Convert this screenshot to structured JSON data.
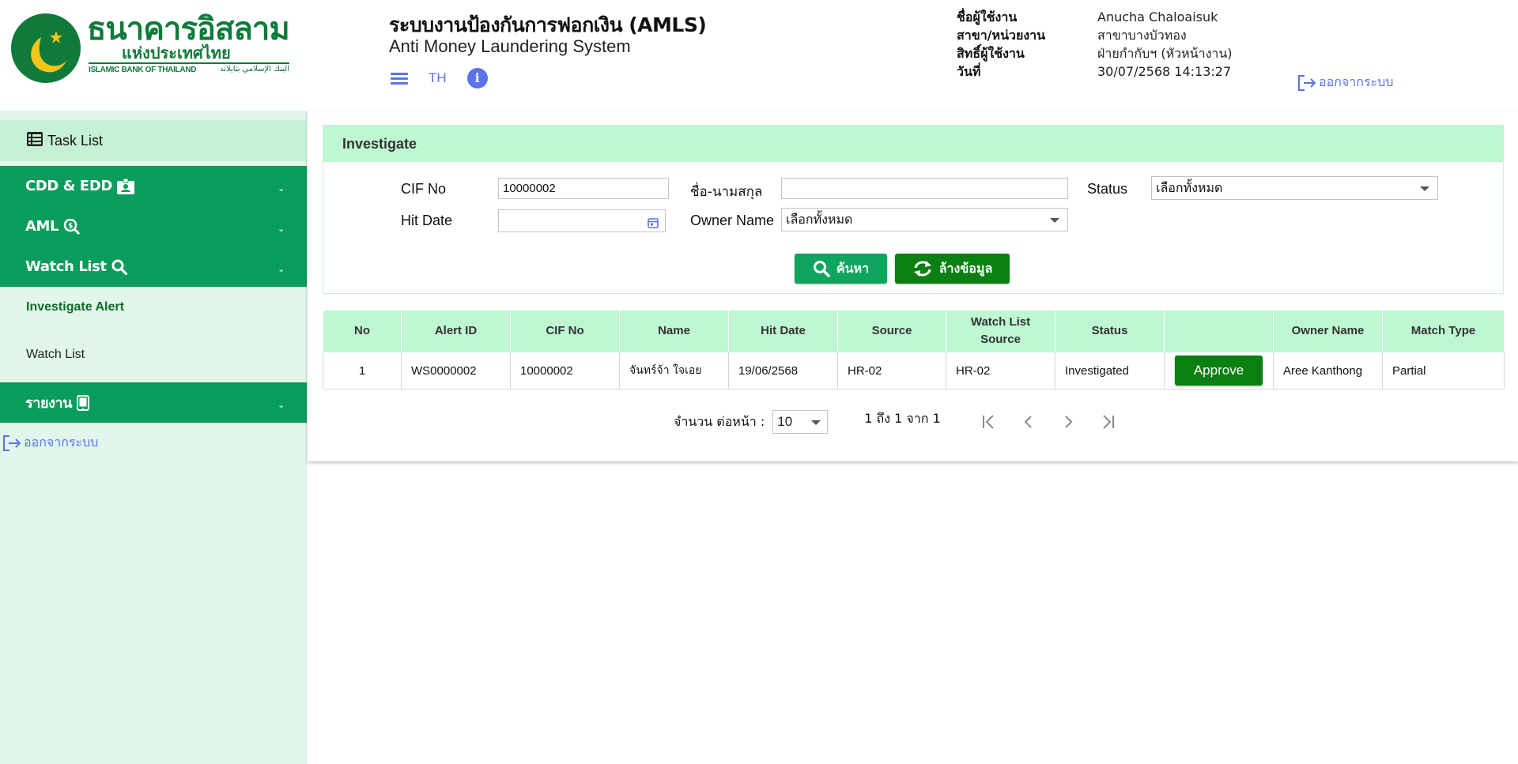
{
  "header": {
    "logo_th": "ธนาคารอิสลาม",
    "logo_th2": "แห่งประเทศไทย",
    "logo_en": "ISLAMIC BANK OF THAILAND",
    "logo_ar": "البنك الإسلامي بتايلاند",
    "system_title": "ระบบงานป้องกันการฟอกเงิน (AMLS)",
    "system_subtitle": "Anti Money Laundering System",
    "lang": "TH",
    "info_icon": "info-icon",
    "user": {
      "username_label": "ชื่อผู้ใช้งาน",
      "username": "Anucha Chaloaisuk",
      "branch_label": "สาขา/หน่วยงาน",
      "branch": "สาขาบางบัวทอง",
      "role_label": "สิทธิ์ผู้ใช้งาน",
      "role": "ฝ่ายกำกับฯ (หัวหน้างาน)",
      "date_label": "วันที่",
      "date": "30/07/2568 14:13:27"
    },
    "logout": "ออกจากระบบ"
  },
  "sidebar": {
    "task_list": "Task List",
    "groups": [
      {
        "label": "CDD & EDD",
        "icon": "id-badge-icon"
      },
      {
        "label": "AML",
        "icon": "money-search-icon"
      },
      {
        "label": "Watch List",
        "icon": "search-icon"
      }
    ],
    "sub_items": [
      "Investigate Alert",
      "Watch List"
    ],
    "report": {
      "label": "รายงาน",
      "icon": "tablet-icon"
    },
    "logout": "ออกจากระบบ"
  },
  "search": {
    "title": "Investigate",
    "cif_label": "CIF No",
    "cif_value": "10000002",
    "name_label": "ชื่อ-นามสกุล",
    "name_value": "",
    "status_label": "Status",
    "status_value": "เลือกทั้งหมด",
    "hit_date_label": "Hit Date",
    "hit_date_value": "",
    "owner_label": "Owner Name",
    "owner_value": "เลือกทั้งหมด",
    "search_button": "ค้นหา",
    "clear_button": "ล้างข้อมูล"
  },
  "table": {
    "columns": [
      "No",
      "Alert ID",
      "CIF No",
      "Name",
      "Hit Date",
      "Source",
      "Watch List Source",
      "Status",
      "",
      "Owner Name",
      "Match Type"
    ],
    "rows": [
      {
        "no": "1",
        "alert_id": "WS0000002",
        "cif_no": "10000002",
        "name": "จันทร์จ้า ใจเอย",
        "hit_date": "19/06/2568",
        "source": "HR-02",
        "watch_list_source": "HR-02",
        "status": "Investigated",
        "action": "Approve",
        "owner_name": "Aree Kanthong",
        "match_type": "Partial"
      }
    ]
  },
  "pager": {
    "per_page_label": "จำนวน ต่อหน้า :",
    "per_page": "10",
    "range": "1 ถึง 1 จาก 1"
  },
  "colors": {
    "brand_green": "#0f7a3a",
    "sidebar_group": "#0a9c5c",
    "sidebar_bg": "#e0f7ea",
    "header_mint": "#bff7d3",
    "approve_green": "#0b7f12",
    "link_blue": "#5a73e8"
  }
}
